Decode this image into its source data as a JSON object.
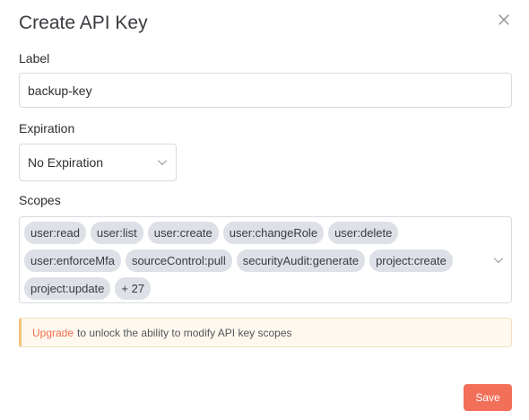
{
  "dialog": {
    "title": "Create API Key"
  },
  "label_field": {
    "label": "Label",
    "value": "backup-key"
  },
  "expiration_field": {
    "label": "Expiration",
    "selected": "No Expiration"
  },
  "scopes_field": {
    "label": "Scopes",
    "tags": [
      "user:read",
      "user:list",
      "user:create",
      "user:changeRole",
      "user:delete",
      "user:enforceMfa",
      "sourceControl:pull",
      "securityAudit:generate",
      "project:create",
      "project:update"
    ],
    "more": "+ 27"
  },
  "notice": {
    "link": "Upgrade",
    "text": "to unlock the ability to modify API key scopes"
  },
  "actions": {
    "save": "Save"
  },
  "icons": {
    "close": "close-icon",
    "chevron": "chevron-down-icon"
  },
  "colors": {
    "accent": "#f27059",
    "tag_bg": "#dde0e6",
    "notice_bg": "#fef8ef",
    "notice_border": "#f4c27b"
  }
}
